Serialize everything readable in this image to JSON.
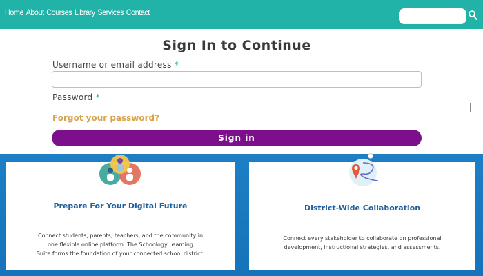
{
  "header": {
    "nav": [
      "Home",
      "About",
      "Courses",
      "Library",
      "Services",
      "Contact"
    ],
    "search_placeholder": ""
  },
  "signin": {
    "title": "Sign In to Continue",
    "username_label": "Username or email address",
    "password_label": "Password",
    "required_mark": "*",
    "forgot_link": "Forgot your password?",
    "submit": "Sign in"
  },
  "features": [
    {
      "title": "Prepare For Your Digital Future",
      "lines": [
        "Connect students, parents, teachers, and the community in",
        "one flexible online platform. The Schoology Learning",
        "Suite forms the foundation of your connected school district."
      ],
      "icon": "people-group-icon"
    },
    {
      "title": "District-Wide Collaboration",
      "lines": [
        "Connect every stakeholder to collaborate on professional",
        "development, instructional strategies, and assessments."
      ],
      "icon": "map-route-icon"
    }
  ],
  "colors": {
    "header_teal": "#21b3a8",
    "signin_purple": "#7d0f8c",
    "forgot_gold": "#d8a34a",
    "band_blue": "#1d7fc4",
    "card_title_blue": "#1f5f9e"
  }
}
